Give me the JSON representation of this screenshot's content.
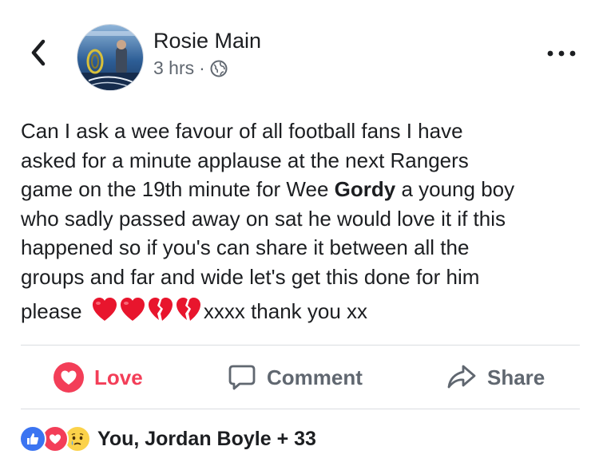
{
  "header": {
    "author_name": "Rosie Main",
    "time": "3 hrs",
    "separator": "·",
    "privacy_icon": "globe-icon",
    "back_icon": "chevron-left-icon",
    "more_icon": "more-dots-icon"
  },
  "post": {
    "lines": [
      "Can I ask a wee favour of all  football fans  I have",
      "asked for a minute applause at the next  Rangers",
      "game  on the 19th minute for Wee ",
      "who sadly passed away on sat he would love it if this",
      "happened so if you's can share it between all the",
      "groups and far and wide let's get this done  for him"
    ],
    "bold_name": "Gordy",
    "line3_tail": "  a young boy",
    "last_line_start": "please ",
    "last_line_end": "xxxx thank you xx",
    "emoji": [
      "red-heart",
      "red-heart",
      "broken-heart",
      "broken-heart"
    ]
  },
  "actions": {
    "love_label": "Love",
    "comment_label": "Comment",
    "share_label": "Share"
  },
  "reactions": {
    "summary": "You, Jordan Boyle + 33",
    "icons": [
      "like-icon",
      "love-icon",
      "sad-icon"
    ]
  },
  "colors": {
    "love_red": "#f33e58",
    "like_blue": "#3b74f1",
    "gray_text": "#606770",
    "divider": "#dadde1"
  }
}
